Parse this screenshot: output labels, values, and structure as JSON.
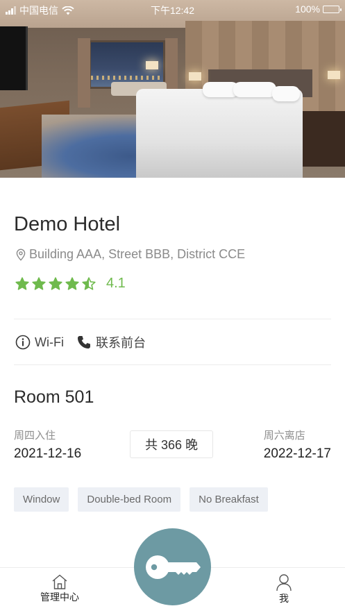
{
  "status_bar": {
    "carrier": "中国电信",
    "time": "下午12:42",
    "battery": "100%",
    "battery_level": 1.0
  },
  "hero": {
    "image_icon": "hotel-room-photo"
  },
  "hotel": {
    "name": "Demo Hotel",
    "address": "Building AAA, Street BBB, District CCE",
    "rating": "4.1",
    "rating_value": 4.1,
    "star_color": "#6fba4d"
  },
  "amenities": {
    "wifi_label": "Wi-Fi",
    "contact_label": "联系前台"
  },
  "room": {
    "title": "Room 501",
    "checkin_label": "周四入住",
    "checkin_date": "2021-12-16",
    "nights_label": "共 366 晚",
    "checkout_label": "周六离店",
    "checkout_date": "2022-12-17",
    "tags": [
      "Window",
      "Double-bed Room",
      "No Breakfast"
    ]
  },
  "bottom_nav": {
    "home_label": "管理中心",
    "me_label": "我",
    "key_button_color": "#6d9aa3"
  }
}
